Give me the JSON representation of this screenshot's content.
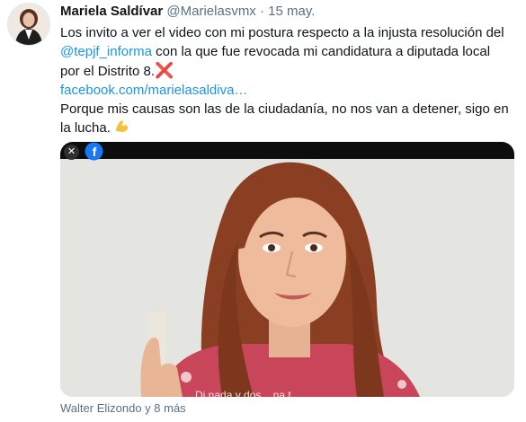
{
  "tweet": {
    "author_name": "Mariela Saldívar",
    "handle": "@Marielasvmx",
    "separator": "·",
    "date": "15 may.",
    "line1": "Los invito a ver el video con mi postura respecto a la injusta resolución del",
    "mention": "@tepjf_informa",
    "line2_rest": " con la que fue revocada mi candidatura a diputada local",
    "line3": "por el Distrito 8.",
    "x_emoji": "❌",
    "link": "facebook.com/marielasaldiva…",
    "line5": "Porque mis causas son las de la ciudadanía, no nos van a detener, sigo en",
    "line6": "la lucha. ",
    "muscle_emoji": "💪"
  },
  "media": {
    "close_glyph": "✕",
    "fb_letter": "f",
    "caption": "Di nada y dos .. na t"
  },
  "tagged": "Walter Elizondo y 8 más",
  "colors": {
    "link": "#1b95e0",
    "muted": "#5b7083",
    "fb": "#1877f2"
  },
  "icons": [
    "close-icon",
    "facebook-icon",
    "flexed-biceps-emoji",
    "cross-mark-emoji"
  ]
}
